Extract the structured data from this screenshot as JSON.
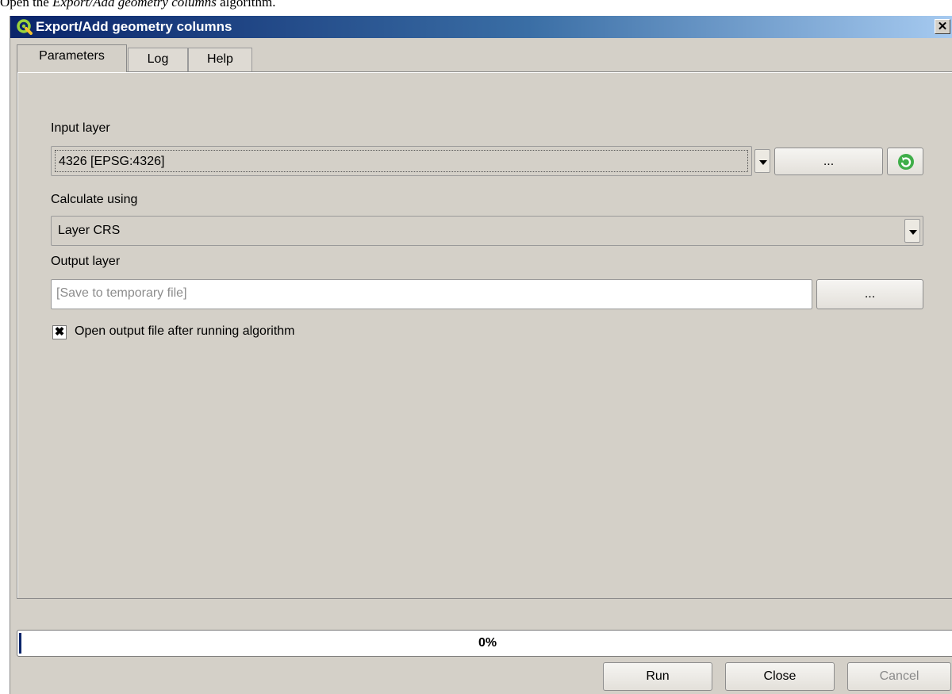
{
  "caption": {
    "prefix": "Open the ",
    "emphasis": "Export/Add geometry columns",
    "suffix": " algorithm."
  },
  "window": {
    "title": "Export/Add geometry columns",
    "close_label": "✕",
    "icon": "qgis-logo-icon"
  },
  "tabs": [
    {
      "label": "Parameters",
      "active": true
    },
    {
      "label": "Log",
      "active": false
    },
    {
      "label": "Help",
      "active": false
    }
  ],
  "form": {
    "input_layer_label": "Input layer",
    "input_layer_value": "4326 [EPSG:4326]",
    "browse_label": "...",
    "iterate_icon": "refresh-iterate-icon",
    "calculate_using_label": "Calculate using",
    "calculate_using_value": "Layer CRS",
    "output_layer_label": "Output layer",
    "output_layer_placeholder": "[Save to temporary file]",
    "output_browse_label": "...",
    "open_output_checked": true,
    "open_output_mark": "✖",
    "open_output_label": "Open output file after running algorithm"
  },
  "progress": {
    "value_percent": 0,
    "text": "0%"
  },
  "buttons": {
    "run": "Run",
    "close": "Close",
    "cancel": "Cancel"
  },
  "colors": {
    "titlebar_start": "#0a246a",
    "titlebar_end": "#a6caf0",
    "dialog_bg": "#d4d0c8",
    "iterate_green": "#3fae49"
  }
}
